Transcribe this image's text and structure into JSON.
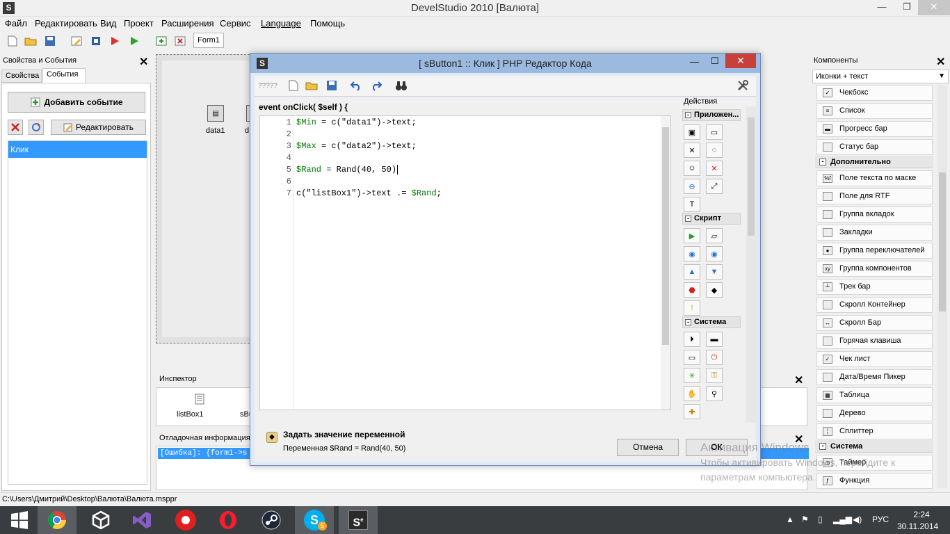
{
  "window": {
    "title": "DevelStudio 2010 [Валюта]",
    "icon_letter": "S",
    "minimize": "—",
    "maximize": "❐",
    "close": "✕"
  },
  "menu": [
    "Файл",
    "Редактировать",
    "Вид",
    "Проект",
    "Расширения",
    "Сервис",
    "Language",
    "Помощь"
  ],
  "toolbar": {
    "form_tab": "Form1"
  },
  "left_panel": {
    "title": "Свойства и События",
    "tabs": [
      "Свойства",
      "События"
    ],
    "active_tab": "События",
    "add_event_label": "Добавить событие",
    "edit_label": "Редактировать",
    "events": [
      "Клик"
    ]
  },
  "designer": {
    "components": [
      "data1",
      "d"
    ]
  },
  "inspector": {
    "title": "Инспектор",
    "items": [
      "listBox1",
      "sBu"
    ]
  },
  "debug": {
    "title": "Отладочная информация",
    "line": "[Ошибка]: {form1->s"
  },
  "components_panel": {
    "title": "Компоненты",
    "view_mode": "Иконки + текст",
    "items_top": [
      "Чекбокс",
      "Список",
      "Прогресс бар",
      "Статус бар"
    ],
    "group_additional": "Дополнительно",
    "items_additional": [
      "Поле текста по маске",
      "Поле для RTF",
      "Группа вкладок",
      "Закладки",
      "Группа переключателей",
      "Группа компонентов",
      "Трек бар",
      "Скролл Контейнер",
      "Скролл Бар",
      "Горячая клавиша",
      "Чек лист",
      "Дата/Время Пикер",
      "Таблица",
      "Дерево",
      "Сплиттер"
    ],
    "group_system": "Система",
    "items_system": [
      "Таймер",
      "Функция"
    ]
  },
  "dialog": {
    "title": "[ sButton1 :: Клик ] PHP Редактор Кода",
    "icon_letter": "S",
    "toolbar_label": "?????",
    "event_header": "event onClick( $self ) {",
    "code_lines": [
      {
        "n": "1",
        "var": "$Min",
        "rest": " = c(\"data1\")->text;"
      },
      {
        "n": "2",
        "var": "",
        "rest": ""
      },
      {
        "n": "3",
        "var": "$Max",
        "rest": " = c(\"data2\")->text;"
      },
      {
        "n": "4",
        "var": "",
        "rest": ""
      },
      {
        "n": "5",
        "var": "$Rand",
        "rest": " = Rand(40, 50)"
      },
      {
        "n": "6",
        "var": "",
        "rest": ""
      },
      {
        "n": "7",
        "pre": "c(\"listBox1\")->text .= ",
        "var": "$Rand",
        "rest": ";"
      }
    ],
    "actions_title": "Действия",
    "action_groups": [
      "Приложен...",
      "Скрипт",
      "Система"
    ],
    "footer_title": "Задать значение переменной",
    "footer_desc": "Переменная $Rand = Rand(40, 50)",
    "cancel_label": "Отмена",
    "ok_label": "ОК"
  },
  "watermark": {
    "line1": "Активация Windows",
    "line2": "Чтобы активировать Windows, перейдите к",
    "line3": "параметрам компьютера."
  },
  "statusbar": {
    "path": "C:\\Users\\Дмитрий\\Desktop\\Валюта\\Валюта.msppr"
  },
  "taskbar": {
    "language": "РУС",
    "time": "2:24",
    "date": "30.11.2014",
    "skype_badge": "5"
  }
}
